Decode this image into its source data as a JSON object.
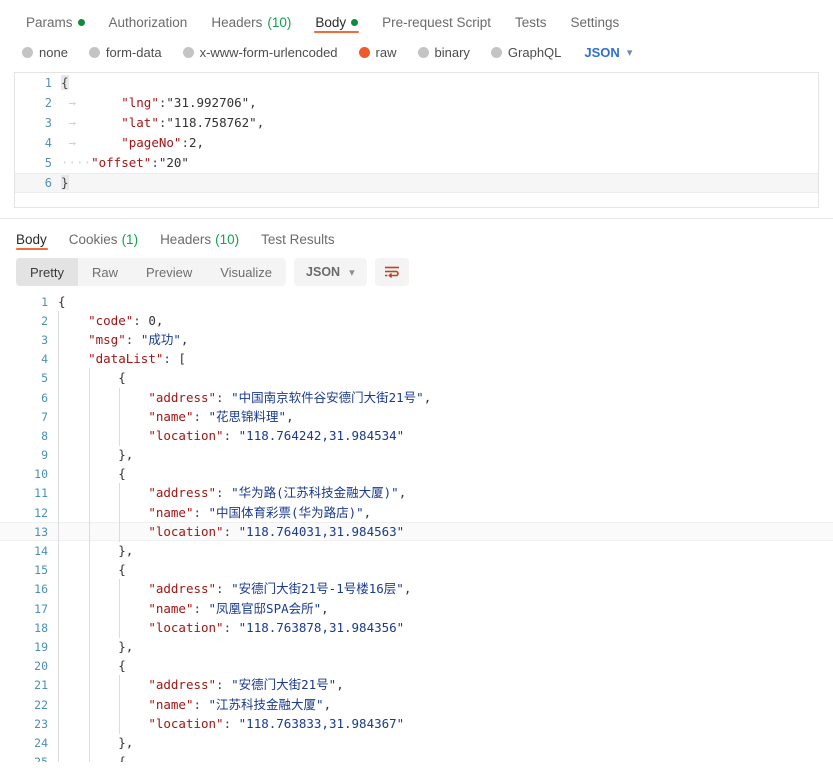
{
  "request": {
    "tabs": [
      {
        "label": "Params",
        "dot": true,
        "count": null,
        "active": false
      },
      {
        "label": "Authorization",
        "dot": false,
        "count": null,
        "active": false
      },
      {
        "label": "Headers",
        "dot": false,
        "count": "(10)",
        "active": false
      },
      {
        "label": "Body",
        "dot": true,
        "count": null,
        "active": true
      },
      {
        "label": "Pre-request Script",
        "dot": false,
        "count": null,
        "active": false
      },
      {
        "label": "Tests",
        "dot": false,
        "count": null,
        "active": false
      },
      {
        "label": "Settings",
        "dot": false,
        "count": null,
        "active": false
      }
    ],
    "body_types": [
      {
        "label": "none",
        "selected": false
      },
      {
        "label": "form-data",
        "selected": false
      },
      {
        "label": "x-www-form-urlencoded",
        "selected": false
      },
      {
        "label": "raw",
        "selected": true
      },
      {
        "label": "binary",
        "selected": false
      },
      {
        "label": "GraphQL",
        "selected": false
      }
    ],
    "format_label": "JSON",
    "format_chevron": "chevron-down-icon",
    "editor": {
      "lines": [
        {
          "no": "1",
          "text": "{"
        },
        {
          "no": "2",
          "text": "    \"lng\":\"31.992706\","
        },
        {
          "no": "3",
          "text": "    \"lat\":\"118.758762\","
        },
        {
          "no": "4",
          "text": "    \"pageNo\":2,"
        },
        {
          "no": "5",
          "text": "    \"offset\":\"20\""
        },
        {
          "no": "6",
          "text": "}"
        }
      ],
      "json": {
        "lng": "31.992706",
        "lat": "118.758762",
        "pageNo": 2,
        "offset": "20"
      }
    }
  },
  "response": {
    "tabs": [
      {
        "label": "Body",
        "count": null,
        "active": true
      },
      {
        "label": "Cookies",
        "count": "(1)",
        "active": false
      },
      {
        "label": "Headers",
        "count": "(10)",
        "active": false
      },
      {
        "label": "Test Results",
        "count": null,
        "active": false
      }
    ],
    "view_modes": [
      {
        "label": "Pretty",
        "active": true
      },
      {
        "label": "Raw",
        "active": false
      },
      {
        "label": "Preview",
        "active": false
      },
      {
        "label": "Visualize",
        "active": false
      }
    ],
    "format_label": "JSON",
    "format_chevron": "chevron-down-icon",
    "wrap_icon": "word-wrap-icon",
    "body": {
      "code": 0,
      "msg": "成功",
      "dataList": [
        {
          "address": "中国南京软件谷安德门大街21号",
          "name": "花思锦料理",
          "location": "118.764242,31.984534"
        },
        {
          "address": "华为路(江苏科技金融大厦)",
          "name": "中国体育彩票(华为路店)",
          "location": "118.764031,31.984563"
        },
        {
          "address": "安德门大街21号-1号楼16层",
          "name": "凤凰官邸SPA会所",
          "location": "118.763878,31.984356"
        },
        {
          "address": "安德门大街21号",
          "name": "江苏科技金融大厦",
          "location": "118.763833,31.984367"
        }
      ],
      "lines": [
        {
          "no": "1",
          "text": "{"
        },
        {
          "no": "2",
          "text": "    \"code\": 0,"
        },
        {
          "no": "3",
          "text": "    \"msg\": \"成功\","
        },
        {
          "no": "4",
          "text": "    \"dataList\": ["
        },
        {
          "no": "5",
          "text": "        {"
        },
        {
          "no": "6",
          "text": "            \"address\": \"中国南京软件谷安德门大街21号\","
        },
        {
          "no": "7",
          "text": "            \"name\": \"花思锦料理\","
        },
        {
          "no": "8",
          "text": "            \"location\": \"118.764242,31.984534\""
        },
        {
          "no": "9",
          "text": "        },"
        },
        {
          "no": "10",
          "text": "        {"
        },
        {
          "no": "11",
          "text": "            \"address\": \"华为路(江苏科技金融大厦)\","
        },
        {
          "no": "12",
          "text": "            \"name\": \"中国体育彩票(华为路店)\","
        },
        {
          "no": "13",
          "text": "            \"location\": \"118.764031,31.984563\""
        },
        {
          "no": "14",
          "text": "        },"
        },
        {
          "no": "15",
          "text": "        {"
        },
        {
          "no": "16",
          "text": "            \"address\": \"安德门大街21号-1号楼16层\","
        },
        {
          "no": "17",
          "text": "            \"name\": \"凤凰官邸SPA会所\","
        },
        {
          "no": "18",
          "text": "            \"location\": \"118.763878,31.984356\""
        },
        {
          "no": "19",
          "text": "        },"
        },
        {
          "no": "20",
          "text": "        {"
        },
        {
          "no": "21",
          "text": "            \"address\": \"安德门大街21号\","
        },
        {
          "no": "22",
          "text": "            \"name\": \"江苏科技金融大厦\","
        },
        {
          "no": "23",
          "text": "            \"location\": \"118.763833,31.984367\""
        },
        {
          "no": "24",
          "text": "        },"
        },
        {
          "no": "25",
          "text": "        {"
        }
      ]
    }
  },
  "colors": {
    "accent_orange": "#f26b3a",
    "radio_selected": "#f05a28",
    "dot_green": "#0f8a3c",
    "count_green": "#12a150",
    "link_blue": "#2f6fd0",
    "json_key": "#a31515",
    "json_string": "#1a3a8f",
    "json_number": "#1c7dbb",
    "gutter_blue": "#4a90b8"
  }
}
